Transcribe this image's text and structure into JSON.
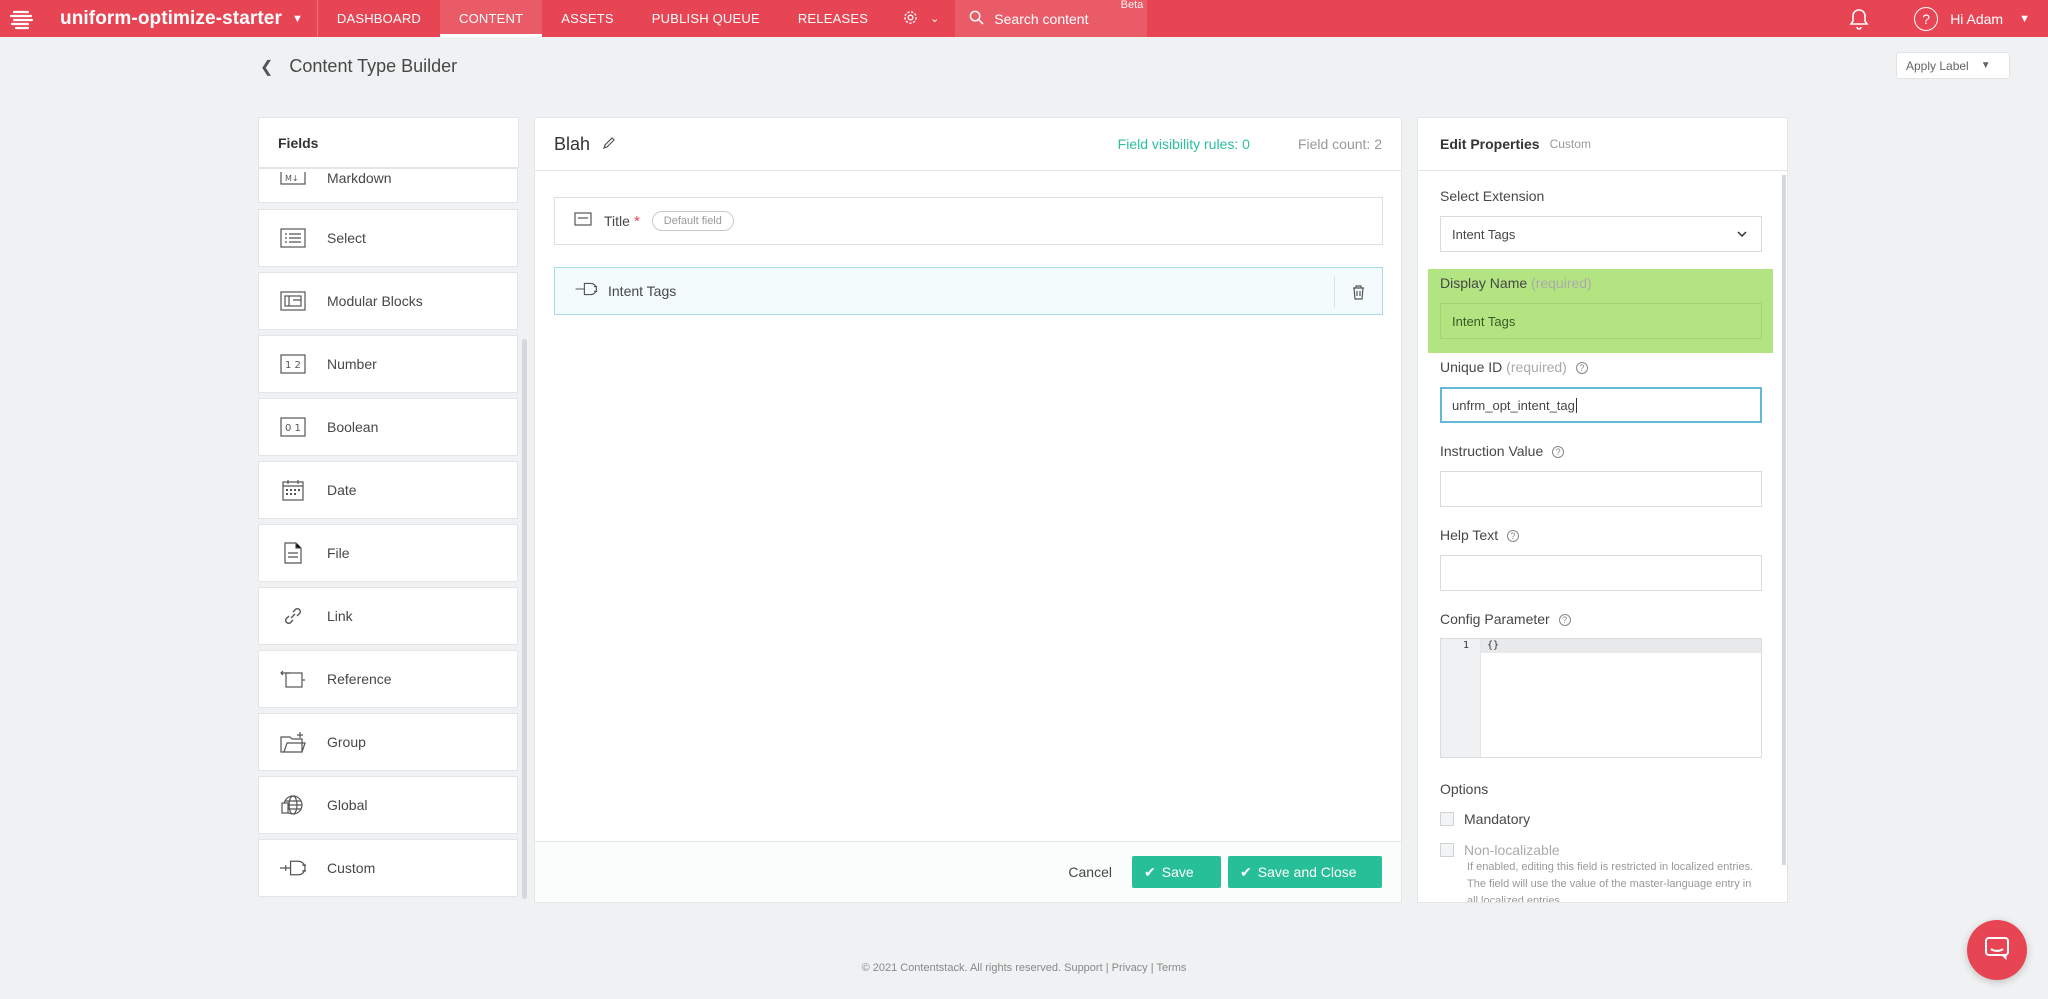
{
  "topnav": {
    "stack_name": "uniform-optimize-starter",
    "items": [
      {
        "label": "DASHBOARD"
      },
      {
        "label": "CONTENT",
        "active": true
      },
      {
        "label": "ASSETS"
      },
      {
        "label": "PUBLISH QUEUE"
      },
      {
        "label": "RELEASES"
      }
    ],
    "search_placeholder": "Search content",
    "beta_label": "Beta",
    "user_label": "Hi  Adam",
    "brand_color": "#e84554"
  },
  "header": {
    "title": "Content Type Builder",
    "apply_label": "Apply Label"
  },
  "fields_panel": {
    "heading": "Fields",
    "items": [
      {
        "label": "Markdown",
        "icon": "markdown-icon"
      },
      {
        "label": "Select",
        "icon": "select-icon"
      },
      {
        "label": "Modular Blocks",
        "icon": "modular-blocks-icon"
      },
      {
        "label": "Number",
        "icon": "number-icon"
      },
      {
        "label": "Boolean",
        "icon": "boolean-icon"
      },
      {
        "label": "Date",
        "icon": "calendar-icon"
      },
      {
        "label": "File",
        "icon": "file-icon"
      },
      {
        "label": "Link",
        "icon": "link-icon"
      },
      {
        "label": "Reference",
        "icon": "reference-icon"
      },
      {
        "label": "Group",
        "icon": "folder-icon"
      },
      {
        "label": "Global",
        "icon": "globe-icon"
      },
      {
        "label": "Custom",
        "icon": "plug-icon"
      }
    ]
  },
  "builder": {
    "content_type_name": "Blah",
    "visibility_rules": "Field visibility rules: 0",
    "field_count": "Field count: 2",
    "rows": [
      {
        "label": "Title",
        "required_mark": "*",
        "pill": "Default field"
      },
      {
        "label": "Intent Tags"
      }
    ],
    "cancel_label": "Cancel",
    "save_label": "Save",
    "save_close_label": "Save and Close",
    "accent_color": "#27bf97"
  },
  "properties": {
    "title": "Edit Properties",
    "subtitle": "Custom",
    "select_extension_label": "Select Extension",
    "select_extension_value": "Intent Tags",
    "display_name_label": "Display Name",
    "display_name_hint": "(required)",
    "display_name_value": "Intent Tags",
    "unique_id_label": "Unique ID",
    "unique_id_hint": "(required)",
    "unique_id_value": "unfrm_opt_intent_tag",
    "instruction_label": "Instruction Value",
    "instruction_value": "",
    "help_text_label": "Help Text",
    "help_text_value": "",
    "config_label": "Config Parameter",
    "config_line_number": "1",
    "config_value": "{}",
    "options_label": "Options",
    "mandatory_label": "Mandatory",
    "non_localizable_label": "Non-localizable",
    "non_localizable_desc": "If enabled, editing this field is restricted in localized entries. The field will use the value of the master-language entry in all localized entries."
  },
  "footer": {
    "copyright": "© 2021 Contentstack. All rights reserved.",
    "support": "Support",
    "privacy": "Privacy",
    "terms": "Terms"
  }
}
